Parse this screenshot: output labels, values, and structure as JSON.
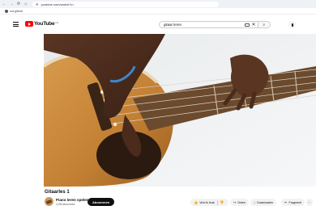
{
  "browser": {
    "url": "youtube.com/watch?v=",
    "bookmark_label": "not-github"
  },
  "header": {
    "logo_text": "YouTube",
    "region": "NL",
    "search_value": "gitaar leren",
    "clear_symbol": "✕",
    "search_symbol": "⌕"
  },
  "video": {
    "title": "Gitaarles 1",
    "channel_name": "Piano leren spelen",
    "subscribers": "4,5M abonnees",
    "subscribe_label": "Abonneren"
  },
  "actions": {
    "like_label": "Vind ik leuk",
    "share_label": "Delen",
    "download_label": "Downloaden",
    "clip_label": "Fragment",
    "more_symbol": "···"
  },
  "colors": {
    "brand_red": "#ff0000",
    "subscribe_bg": "#0f0f0f"
  }
}
